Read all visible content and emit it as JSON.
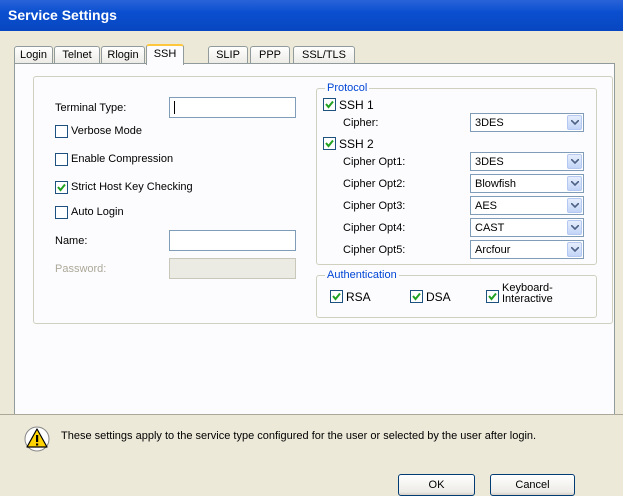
{
  "window": {
    "title": "Service Settings"
  },
  "tabs": [
    {
      "label": "Login"
    },
    {
      "label": "Telnet"
    },
    {
      "label": "Rlogin"
    },
    {
      "label": "SSH"
    },
    {
      "label": "SLIP"
    },
    {
      "label": "PPP"
    },
    {
      "label": "SSL/TLS"
    }
  ],
  "left": {
    "terminal_type_label": "Terminal Type:",
    "terminal_type_value": "",
    "verbose_label": "Verbose Mode",
    "verbose_checked": false,
    "compression_label": "Enable Compression",
    "compression_checked": false,
    "strict_label": "Strict Host Key Checking",
    "strict_checked": true,
    "autologin_label": "Auto Login",
    "autologin_checked": false,
    "name_label": "Name:",
    "name_value": "",
    "password_label": "Password:"
  },
  "protocol": {
    "legend": "Protocol",
    "ssh1_label": "SSH 1",
    "ssh1_checked": true,
    "cipher_label": "Cipher:",
    "cipher_value": "3DES",
    "ssh2_label": "SSH 2",
    "ssh2_checked": true,
    "opts": [
      {
        "label": "Cipher Opt1:",
        "value": "3DES"
      },
      {
        "label": "Cipher Opt2:",
        "value": "Blowfish"
      },
      {
        "label": "Cipher Opt3:",
        "value": "AES"
      },
      {
        "label": "Cipher Opt4:",
        "value": "CAST"
      },
      {
        "label": "Cipher Opt5:",
        "value": "Arcfour"
      }
    ]
  },
  "auth": {
    "legend": "Authentication",
    "rsa_label": "RSA",
    "rsa_checked": true,
    "dsa_label": "DSA",
    "dsa_checked": true,
    "kbd_label_1": "Keyboard-",
    "kbd_label_2": "Interactive",
    "kbd_checked": true
  },
  "info": {
    "message": "These settings apply to the service type configured for the user or selected by the user after login."
  },
  "buttons": {
    "ok": "OK",
    "cancel": "Cancel"
  },
  "colors": {
    "title_bar": "#0A4FD0",
    "accent_tab": "#FFC83C",
    "legend_text": "#0046D5"
  }
}
